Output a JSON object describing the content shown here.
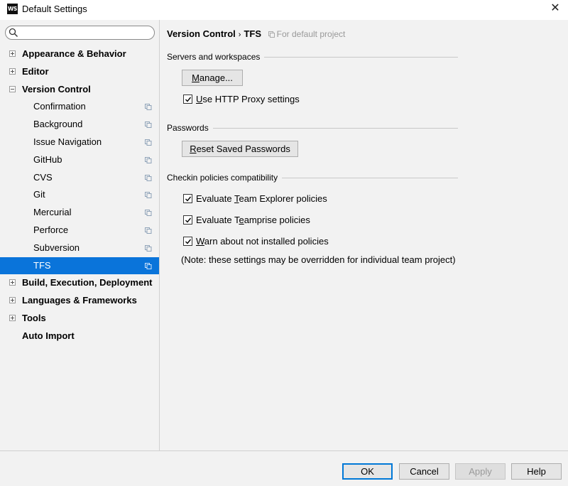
{
  "window": {
    "app_icon_text": "WS",
    "title": "Default Settings",
    "close_glyph": "✕"
  },
  "search": {
    "placeholder": "",
    "value": "",
    "icon": "search-icon"
  },
  "sidebar": {
    "items": [
      {
        "label": "Appearance & Behavior",
        "level": 0,
        "expander": "plus"
      },
      {
        "label": "Editor",
        "level": 0,
        "expander": "plus"
      },
      {
        "label": "Version Control",
        "level": 0,
        "expander": "minus"
      },
      {
        "label": "Confirmation",
        "level": 1,
        "project_icon": true
      },
      {
        "label": "Background",
        "level": 1,
        "project_icon": true
      },
      {
        "label": "Issue Navigation",
        "level": 1,
        "project_icon": true
      },
      {
        "label": "GitHub",
        "level": 1,
        "project_icon": true
      },
      {
        "label": "CVS",
        "level": 1,
        "project_icon": true
      },
      {
        "label": "Git",
        "level": 1,
        "project_icon": true
      },
      {
        "label": "Mercurial",
        "level": 1,
        "project_icon": true
      },
      {
        "label": "Perforce",
        "level": 1,
        "project_icon": true
      },
      {
        "label": "Subversion",
        "level": 1,
        "project_icon": true
      },
      {
        "label": "TFS",
        "level": 1,
        "project_icon": true,
        "selected": true
      },
      {
        "label": "Build, Execution, Deployment",
        "level": 0,
        "expander": "plus"
      },
      {
        "label": "Languages & Frameworks",
        "level": 0,
        "expander": "plus"
      },
      {
        "label": "Tools",
        "level": 0,
        "expander": "plus"
      },
      {
        "label": "Auto Import",
        "level": 0,
        "expander": "none"
      }
    ],
    "selection_color": "#0a74da"
  },
  "breadcrumb": {
    "parent": "Version Control",
    "separator": "›",
    "current": "TFS",
    "note": "For default project"
  },
  "groups": {
    "servers": {
      "title": "Servers and workspaces",
      "manage_button": {
        "mnemonic": "M",
        "rest": "anage..."
      },
      "proxy_checkbox": {
        "checked": true,
        "mnemonic": "U",
        "rest": "se HTTP Proxy settings"
      }
    },
    "passwords": {
      "title": "Passwords",
      "reset_button": {
        "mnemonic": "R",
        "rest": "eset Saved Passwords"
      }
    },
    "checkin": {
      "title": "Checkin policies compatibility",
      "options": [
        {
          "checked": true,
          "before": "Evaluate ",
          "mnemonic": "T",
          "after": "eam Explorer policies"
        },
        {
          "checked": true,
          "before": "Evaluate T",
          "mnemonic": "e",
          "after": "amprise policies"
        },
        {
          "checked": true,
          "before": "",
          "mnemonic": "W",
          "after": "arn about not installed policies"
        }
      ],
      "note": "(Note: these settings may be overridden for individual team project)"
    }
  },
  "footer": {
    "ok": "OK",
    "cancel": "Cancel",
    "apply": "Apply",
    "help": "Help",
    "apply_enabled": false
  }
}
